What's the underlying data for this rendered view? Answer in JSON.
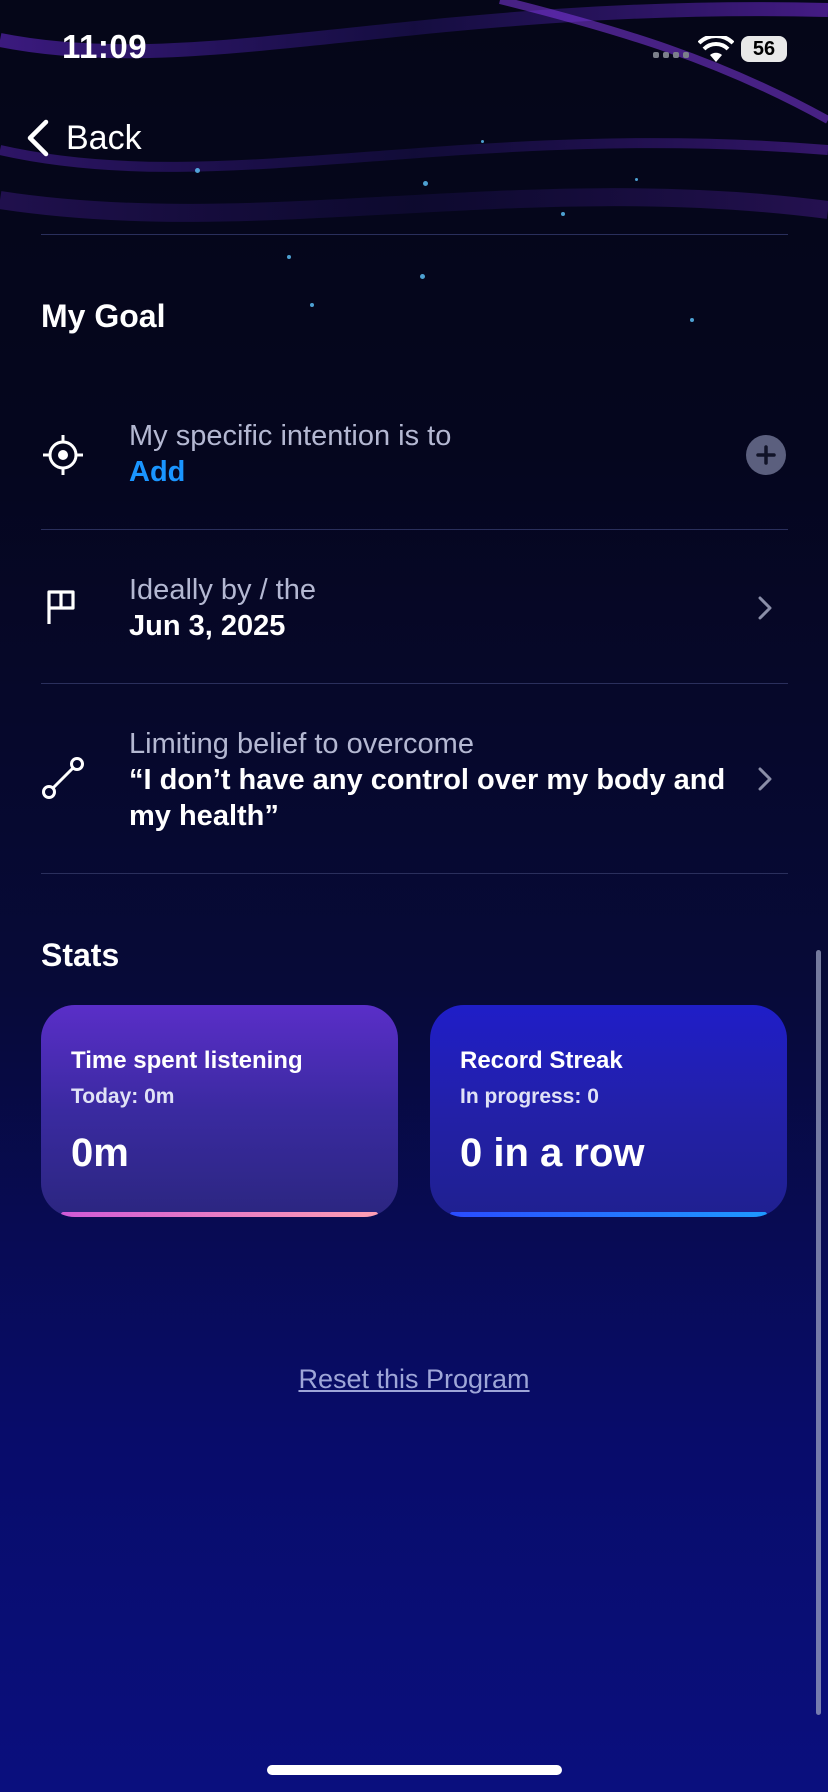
{
  "status_bar": {
    "time": "11:09",
    "battery": "56"
  },
  "nav": {
    "back_label": "Back"
  },
  "goal": {
    "section_title": "My Goal",
    "intention": {
      "label": "My specific intention is to",
      "value": "Add",
      "icon": "target-icon"
    },
    "deadline": {
      "label": "Ideally by / the",
      "value": "Jun 3, 2025",
      "icon": "flag-icon"
    },
    "belief": {
      "label": "Limiting belief to overcome",
      "value": "“I don’t have any control over my body and my health”",
      "icon": "path-icon"
    }
  },
  "stats": {
    "section_title": "Stats",
    "listening": {
      "title": "Time spent listening",
      "subtitle": "Today: 0m",
      "value": "0m"
    },
    "streak": {
      "title": "Record Streak",
      "subtitle": "In progress: 0",
      "value": "0 in a row"
    }
  },
  "reset_label": "Reset this Program",
  "colors": {
    "accent_link": "#1a95ff",
    "card_time": "#4a2cb8",
    "card_streak": "#2020b8"
  }
}
